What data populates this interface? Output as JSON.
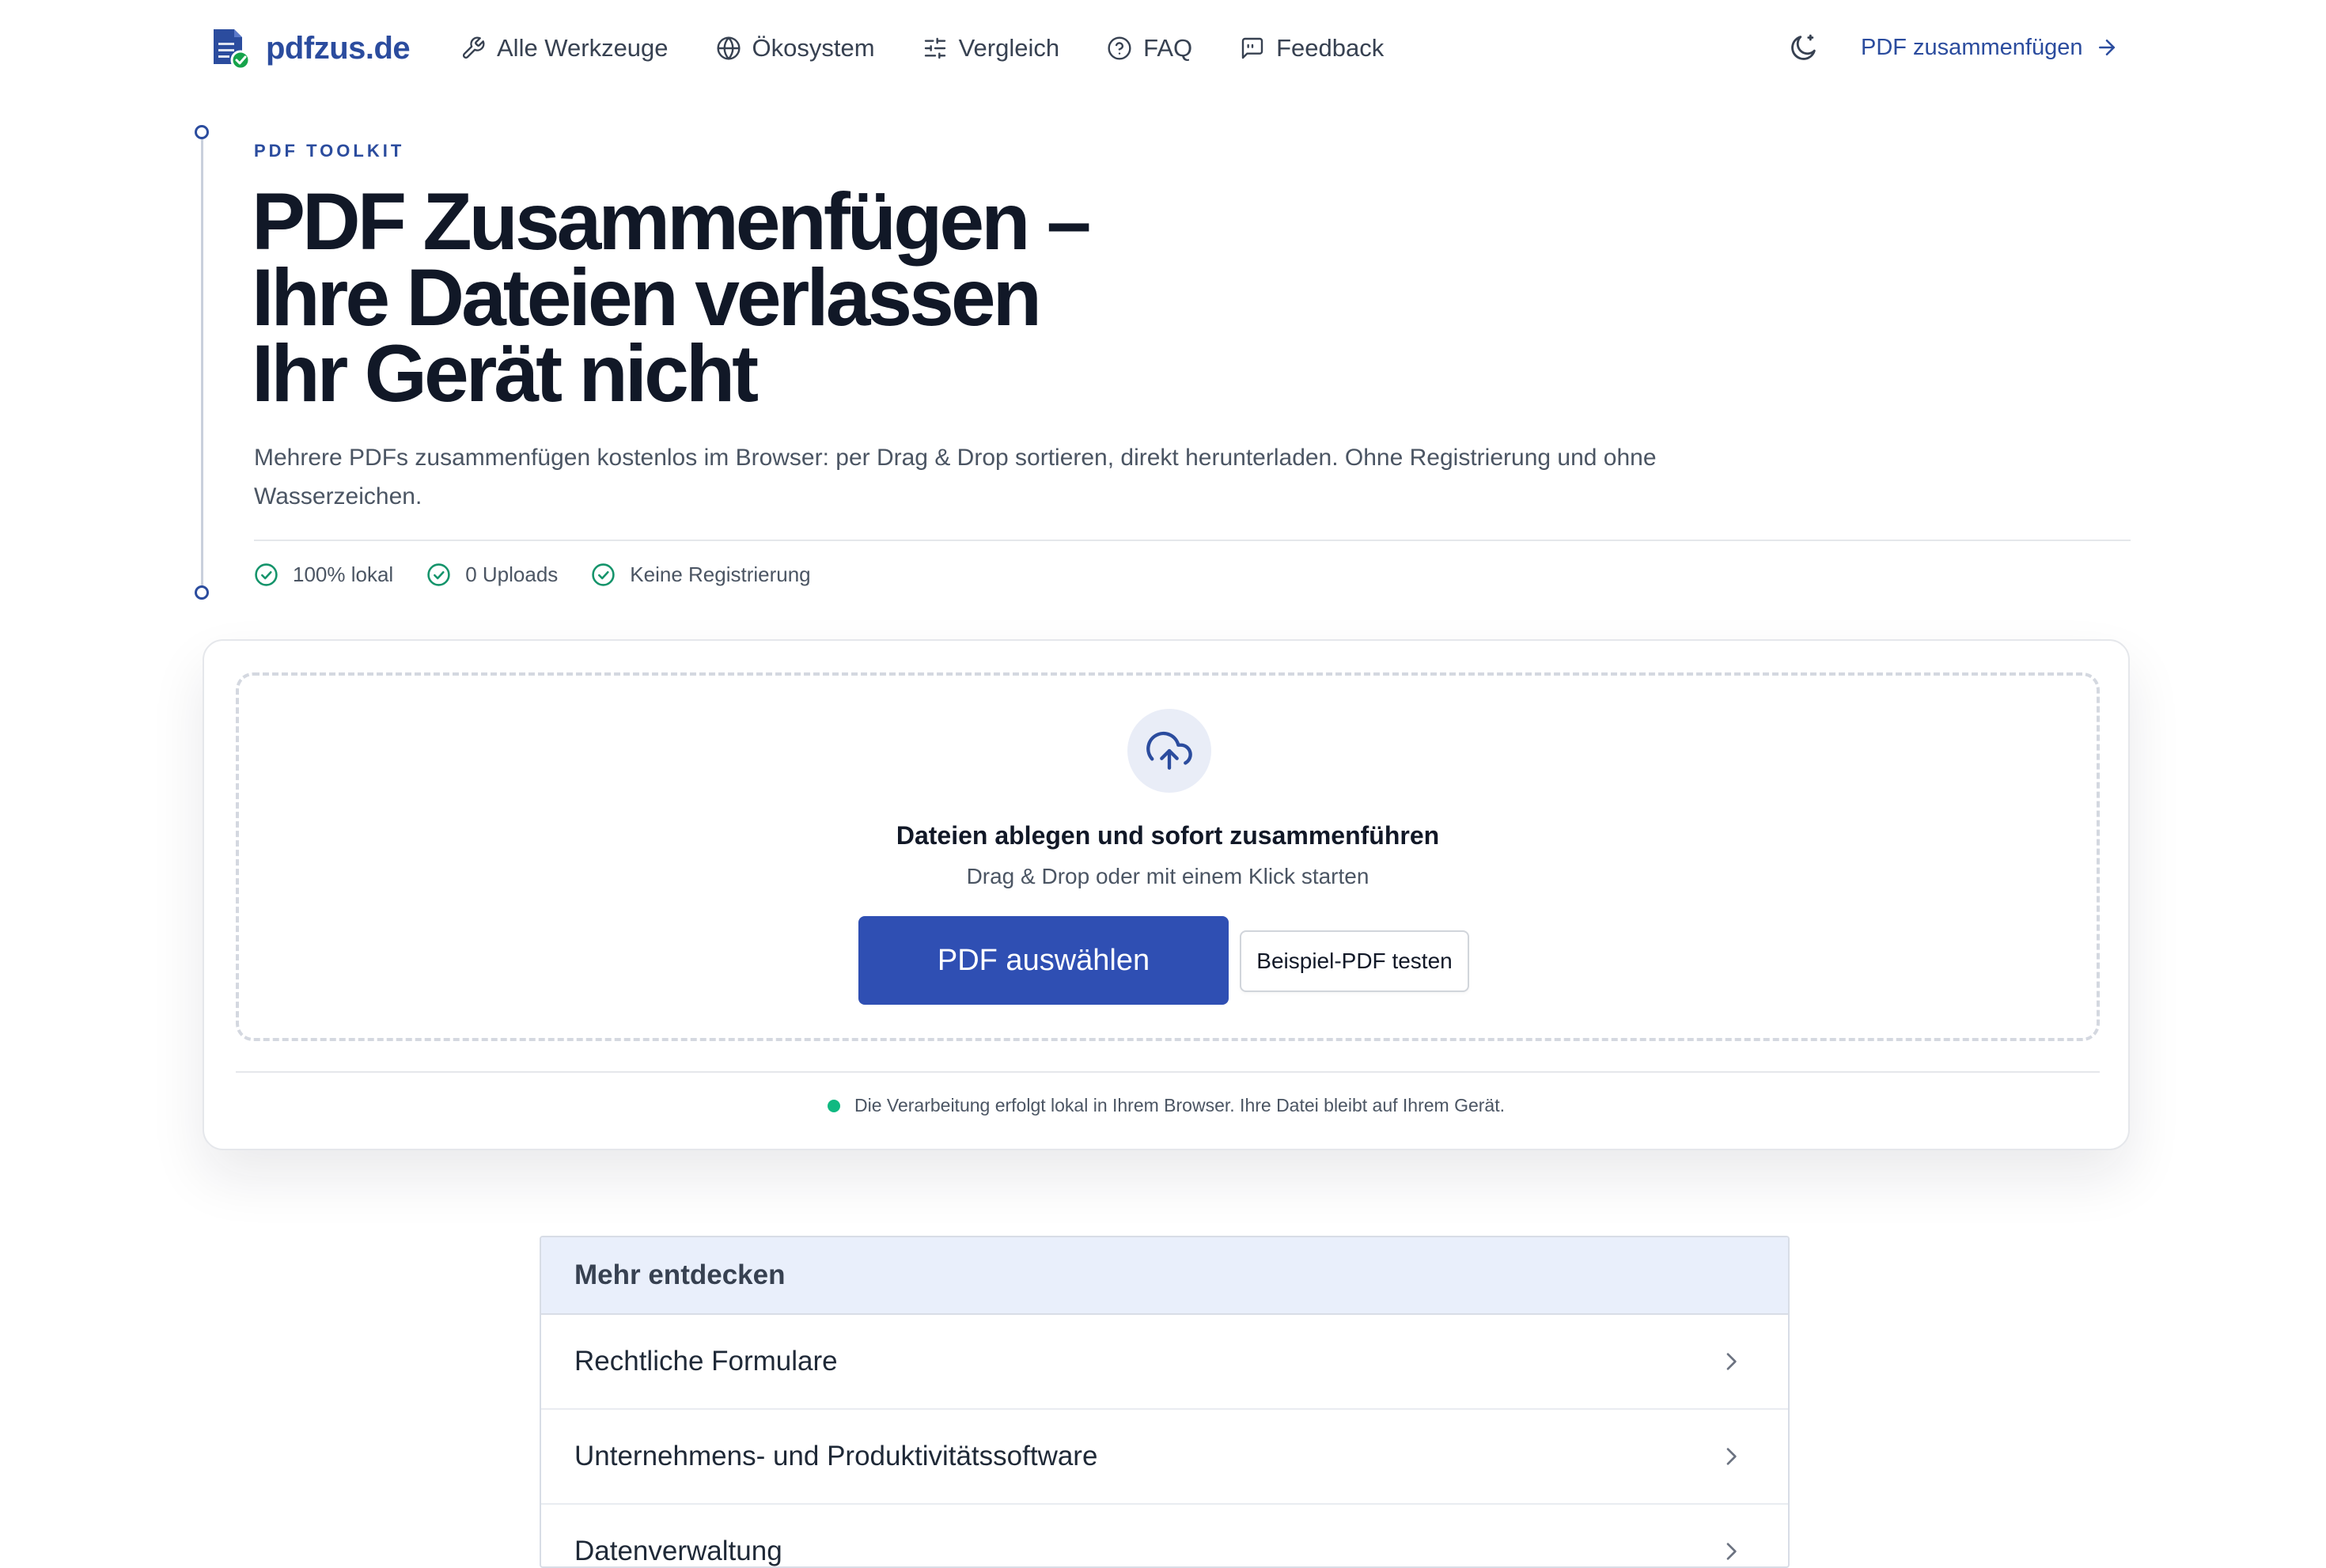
{
  "header": {
    "logo_text": "pdfzus.de",
    "nav": [
      {
        "label": "Alle Werkzeuge",
        "icon": "wrench-icon"
      },
      {
        "label": "Ökosystem",
        "icon": "globe-icon"
      },
      {
        "label": "Vergleich",
        "icon": "sliders-icon"
      },
      {
        "label": "FAQ",
        "icon": "question-circle-icon"
      },
      {
        "label": "Feedback",
        "icon": "message-square-icon"
      }
    ],
    "theme_icon": "moon-icon",
    "cta_label": "PDF zusammenfügen",
    "cta_icon": "arrow-right-icon"
  },
  "hero": {
    "eyebrow": "PDF TOOLKIT",
    "title_lines": [
      "PDF Zusammenfügen –",
      "Ihre Dateien verlassen",
      "Ihr Gerät nicht"
    ],
    "description": "Mehrere PDFs zusammenfügen kostenlos im Browser: per Drag & Drop sortieren, direkt herunterladen. Ohne Registrierung und ohne Wasserzeichen.",
    "badges": [
      "100% lokal",
      "0 Uploads",
      "Keine Registrierung"
    ]
  },
  "upload": {
    "icon": "cloud-upload-icon",
    "title": "Dateien ablegen und sofort zusammenführen",
    "subtitle": "Drag & Drop oder mit einem Klick starten",
    "primary_button": "PDF auswählen",
    "secondary_button": "Beispiel-PDF testen",
    "privacy_note": "Die Verarbeitung erfolgt lokal in Ihrem Browser. Ihre Datei bleibt auf Ihrem Gerät."
  },
  "discover": {
    "title": "Mehr entdecken",
    "items": [
      "Rechtliche Formulare",
      "Unternehmens- und Produktivitätssoftware",
      "Datenverwaltung"
    ]
  },
  "colors": {
    "brand": "#2B4C9E",
    "primary_button": "#2F4FB3",
    "success": "#10b981",
    "badge_check": "#15946b",
    "discover_header": "#e9effb"
  }
}
